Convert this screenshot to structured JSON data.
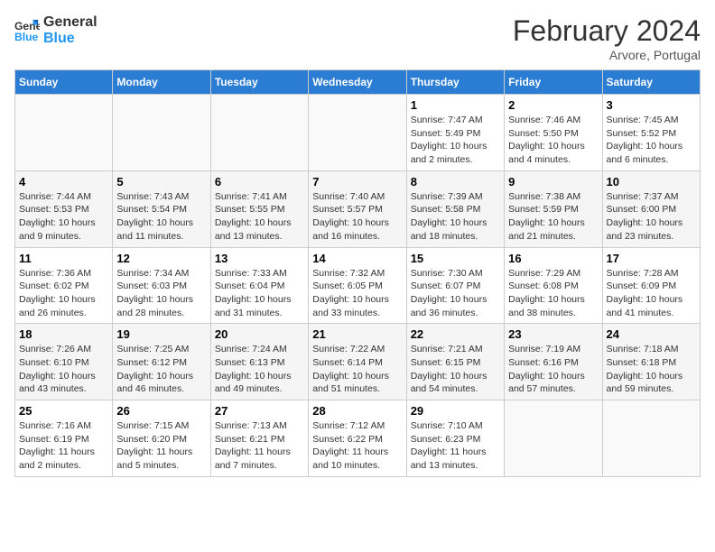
{
  "header": {
    "logo_general": "General",
    "logo_blue": "Blue",
    "month_year": "February 2024",
    "location": "Arvore, Portugal"
  },
  "days_of_week": [
    "Sunday",
    "Monday",
    "Tuesday",
    "Wednesday",
    "Thursday",
    "Friday",
    "Saturday"
  ],
  "weeks": [
    [
      {
        "day": "",
        "info": ""
      },
      {
        "day": "",
        "info": ""
      },
      {
        "day": "",
        "info": ""
      },
      {
        "day": "",
        "info": ""
      },
      {
        "day": "1",
        "info": "Sunrise: 7:47 AM\nSunset: 5:49 PM\nDaylight: 10 hours\nand 2 minutes."
      },
      {
        "day": "2",
        "info": "Sunrise: 7:46 AM\nSunset: 5:50 PM\nDaylight: 10 hours\nand 4 minutes."
      },
      {
        "day": "3",
        "info": "Sunrise: 7:45 AM\nSunset: 5:52 PM\nDaylight: 10 hours\nand 6 minutes."
      }
    ],
    [
      {
        "day": "4",
        "info": "Sunrise: 7:44 AM\nSunset: 5:53 PM\nDaylight: 10 hours\nand 9 minutes."
      },
      {
        "day": "5",
        "info": "Sunrise: 7:43 AM\nSunset: 5:54 PM\nDaylight: 10 hours\nand 11 minutes."
      },
      {
        "day": "6",
        "info": "Sunrise: 7:41 AM\nSunset: 5:55 PM\nDaylight: 10 hours\nand 13 minutes."
      },
      {
        "day": "7",
        "info": "Sunrise: 7:40 AM\nSunset: 5:57 PM\nDaylight: 10 hours\nand 16 minutes."
      },
      {
        "day": "8",
        "info": "Sunrise: 7:39 AM\nSunset: 5:58 PM\nDaylight: 10 hours\nand 18 minutes."
      },
      {
        "day": "9",
        "info": "Sunrise: 7:38 AM\nSunset: 5:59 PM\nDaylight: 10 hours\nand 21 minutes."
      },
      {
        "day": "10",
        "info": "Sunrise: 7:37 AM\nSunset: 6:00 PM\nDaylight: 10 hours\nand 23 minutes."
      }
    ],
    [
      {
        "day": "11",
        "info": "Sunrise: 7:36 AM\nSunset: 6:02 PM\nDaylight: 10 hours\nand 26 minutes."
      },
      {
        "day": "12",
        "info": "Sunrise: 7:34 AM\nSunset: 6:03 PM\nDaylight: 10 hours\nand 28 minutes."
      },
      {
        "day": "13",
        "info": "Sunrise: 7:33 AM\nSunset: 6:04 PM\nDaylight: 10 hours\nand 31 minutes."
      },
      {
        "day": "14",
        "info": "Sunrise: 7:32 AM\nSunset: 6:05 PM\nDaylight: 10 hours\nand 33 minutes."
      },
      {
        "day": "15",
        "info": "Sunrise: 7:30 AM\nSunset: 6:07 PM\nDaylight: 10 hours\nand 36 minutes."
      },
      {
        "day": "16",
        "info": "Sunrise: 7:29 AM\nSunset: 6:08 PM\nDaylight: 10 hours\nand 38 minutes."
      },
      {
        "day": "17",
        "info": "Sunrise: 7:28 AM\nSunset: 6:09 PM\nDaylight: 10 hours\nand 41 minutes."
      }
    ],
    [
      {
        "day": "18",
        "info": "Sunrise: 7:26 AM\nSunset: 6:10 PM\nDaylight: 10 hours\nand 43 minutes."
      },
      {
        "day": "19",
        "info": "Sunrise: 7:25 AM\nSunset: 6:12 PM\nDaylight: 10 hours\nand 46 minutes."
      },
      {
        "day": "20",
        "info": "Sunrise: 7:24 AM\nSunset: 6:13 PM\nDaylight: 10 hours\nand 49 minutes."
      },
      {
        "day": "21",
        "info": "Sunrise: 7:22 AM\nSunset: 6:14 PM\nDaylight: 10 hours\nand 51 minutes."
      },
      {
        "day": "22",
        "info": "Sunrise: 7:21 AM\nSunset: 6:15 PM\nDaylight: 10 hours\nand 54 minutes."
      },
      {
        "day": "23",
        "info": "Sunrise: 7:19 AM\nSunset: 6:16 PM\nDaylight: 10 hours\nand 57 minutes."
      },
      {
        "day": "24",
        "info": "Sunrise: 7:18 AM\nSunset: 6:18 PM\nDaylight: 10 hours\nand 59 minutes."
      }
    ],
    [
      {
        "day": "25",
        "info": "Sunrise: 7:16 AM\nSunset: 6:19 PM\nDaylight: 11 hours\nand 2 minutes."
      },
      {
        "day": "26",
        "info": "Sunrise: 7:15 AM\nSunset: 6:20 PM\nDaylight: 11 hours\nand 5 minutes."
      },
      {
        "day": "27",
        "info": "Sunrise: 7:13 AM\nSunset: 6:21 PM\nDaylight: 11 hours\nand 7 minutes."
      },
      {
        "day": "28",
        "info": "Sunrise: 7:12 AM\nSunset: 6:22 PM\nDaylight: 11 hours\nand 10 minutes."
      },
      {
        "day": "29",
        "info": "Sunrise: 7:10 AM\nSunset: 6:23 PM\nDaylight: 11 hours\nand 13 minutes."
      },
      {
        "day": "",
        "info": ""
      },
      {
        "day": "",
        "info": ""
      }
    ]
  ]
}
